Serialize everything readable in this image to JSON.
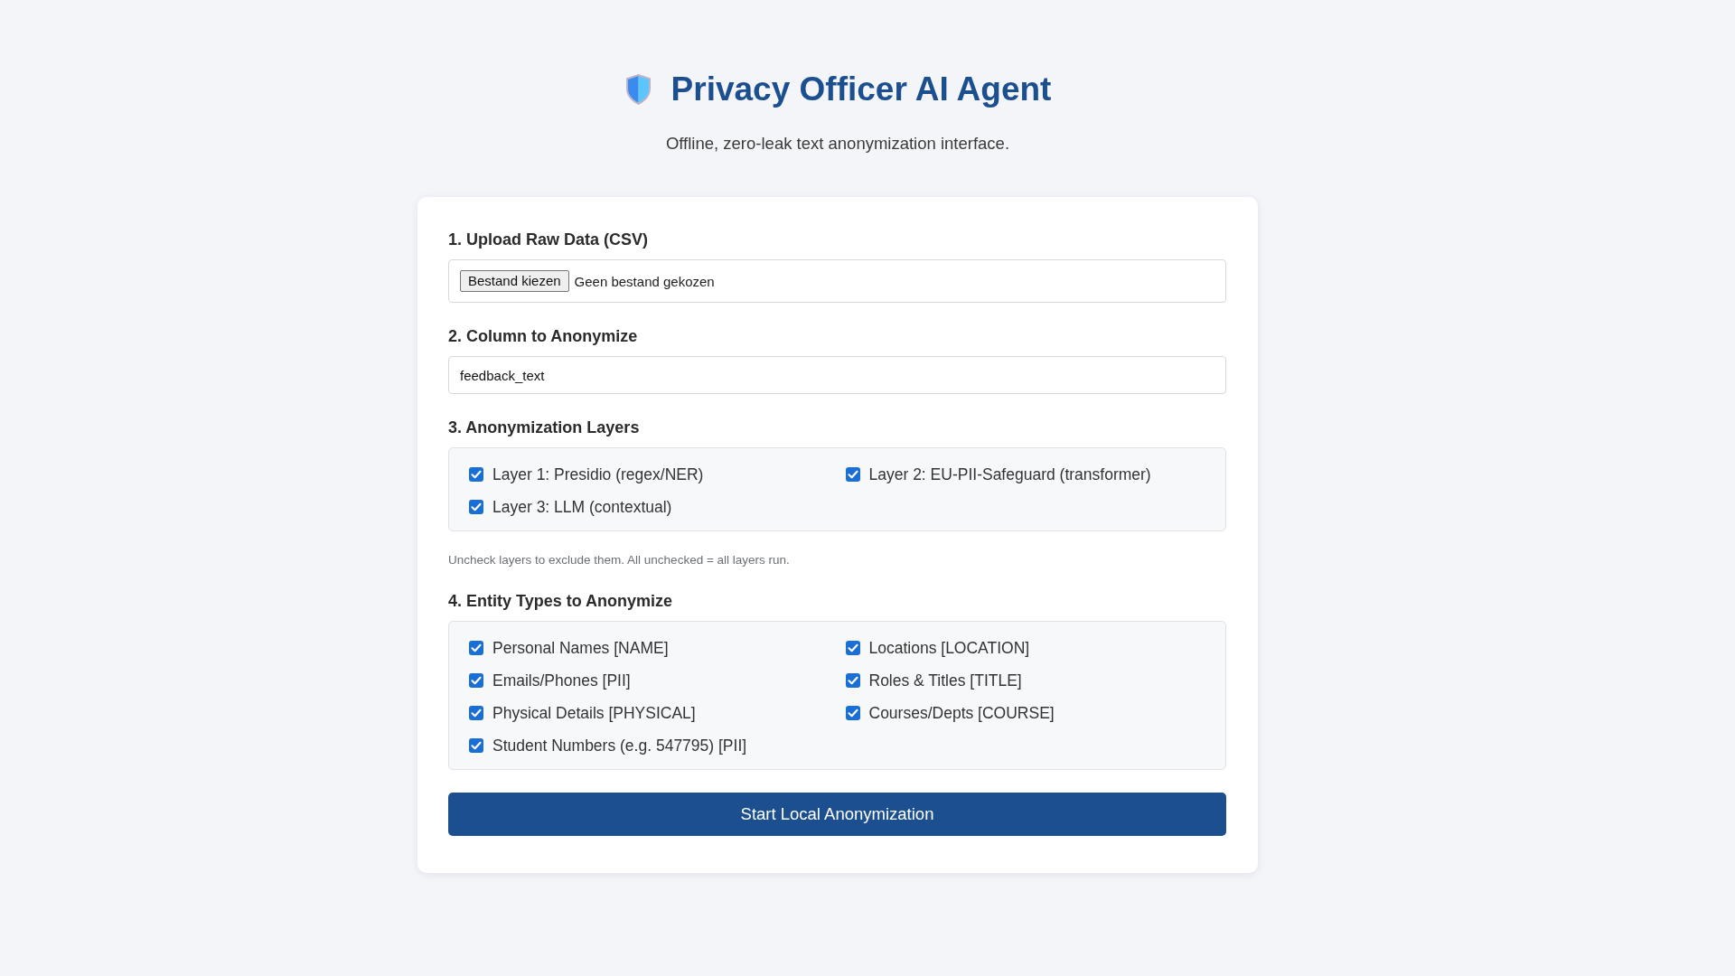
{
  "header": {
    "title": "Privacy Officer AI Agent",
    "subtitle": "Offline, zero-leak text anonymization interface."
  },
  "upload": {
    "label": "1. Upload Raw Data (CSV)",
    "button": "Bestand kiezen",
    "status": "Geen bestand gekozen"
  },
  "column": {
    "label": "2. Column to Anonymize",
    "value": "feedback_text"
  },
  "layers": {
    "label": "3. Anonymization Layers",
    "items": [
      {
        "label": "Layer 1: Presidio (regex/NER)",
        "checked": true
      },
      {
        "label": "Layer 2: EU-PII-Safeguard (transformer)",
        "checked": true
      },
      {
        "label": "Layer 3: LLM (contextual)",
        "checked": true
      }
    ],
    "hint": "Uncheck layers to exclude them. All unchecked = all layers run."
  },
  "entity_types": {
    "label": "4. Entity Types to Anonymize",
    "items": [
      {
        "label": "Personal Names [NAME]",
        "checked": true
      },
      {
        "label": "Locations [LOCATION]",
        "checked": true
      },
      {
        "label": "Emails/Phones [PII]",
        "checked": true
      },
      {
        "label": "Roles & Titles [TITLE]",
        "checked": true
      },
      {
        "label": "Physical Details [PHYSICAL]",
        "checked": true
      },
      {
        "label": "Courses/Depts [COURSE]",
        "checked": true
      },
      {
        "label": "Student Numbers (e.g. 547795) [PII]",
        "checked": true
      }
    ]
  },
  "submit_button": "Start Local Anonymization"
}
